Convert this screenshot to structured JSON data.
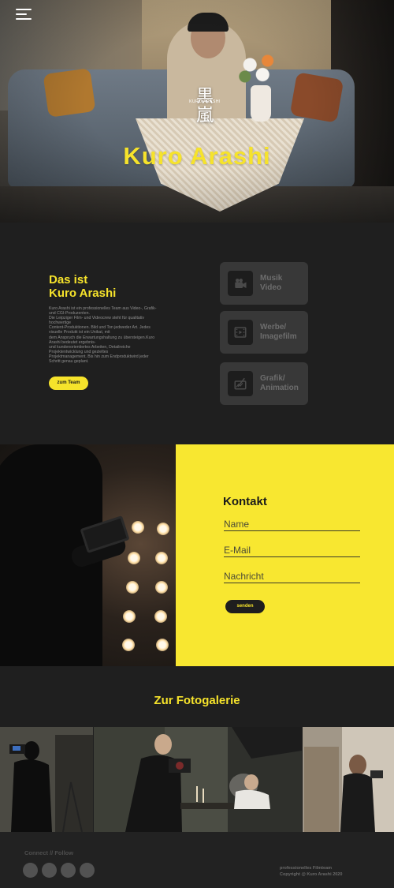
{
  "hero": {
    "title": "Kuro Arashi",
    "logo_kanji_top": "黒",
    "logo_kanji_bottom": "嵐",
    "logo_small_text": "KURO ARASHI",
    "menu_icon": "hamburger-menu-icon"
  },
  "about": {
    "heading_line1": "Das ist",
    "heading_line2": "Kuro Arashi",
    "text": "Kuro Arashi ist ein professionelles Team aus Video-, Grafik-\nund CGI-Produzenten.\nDie Leipziger Film- und Videocrew steht für qualitativ\nhochwertige\nContent-Produktionen. Bild und Ton jedweder Art. Jedes\nvisuelle Produkt ist ein Unikat, mit\ndem Anspruch die Erwartungshaltung zu übersteigen.Kuro\nArashi bedeutet ergebnis-\nund kundenorientiertes Arbeiten, Detailreiche\nProjektentwicklung und gezieltes\nProjektmanagement. Bis hin zum Endproduktwird jeder\nSchritt genau geplant.",
    "team_button": "zum Team",
    "services": [
      {
        "label": "Musik\nVideo",
        "icon": "video-camera-icon"
      },
      {
        "label": "Werbe/\nImagefilm",
        "icon": "film-play-icon"
      },
      {
        "label": "Grafik/\nAnimation",
        "icon": "graphic-tablet-icon"
      }
    ]
  },
  "contact": {
    "heading": "Kontakt",
    "name_placeholder": "Name",
    "email_placeholder": "E-Mail",
    "message_placeholder": "Nachricht",
    "send_button": "senden"
  },
  "gallery": {
    "heading": "Zur Fotogalerie"
  },
  "footer": {
    "connect_label": "Connect // Follow",
    "info_line1": "professionelles Filmteam",
    "info_line2": "Copyright @ Kuro Arashi 2020",
    "social_icons": [
      "social-icon-1",
      "social-icon-2",
      "social-icon-3",
      "social-icon-4"
    ]
  },
  "colors": {
    "accent_yellow": "#f6e32b",
    "background_dark": "#1f1f1f",
    "card_gray": "#383838"
  }
}
